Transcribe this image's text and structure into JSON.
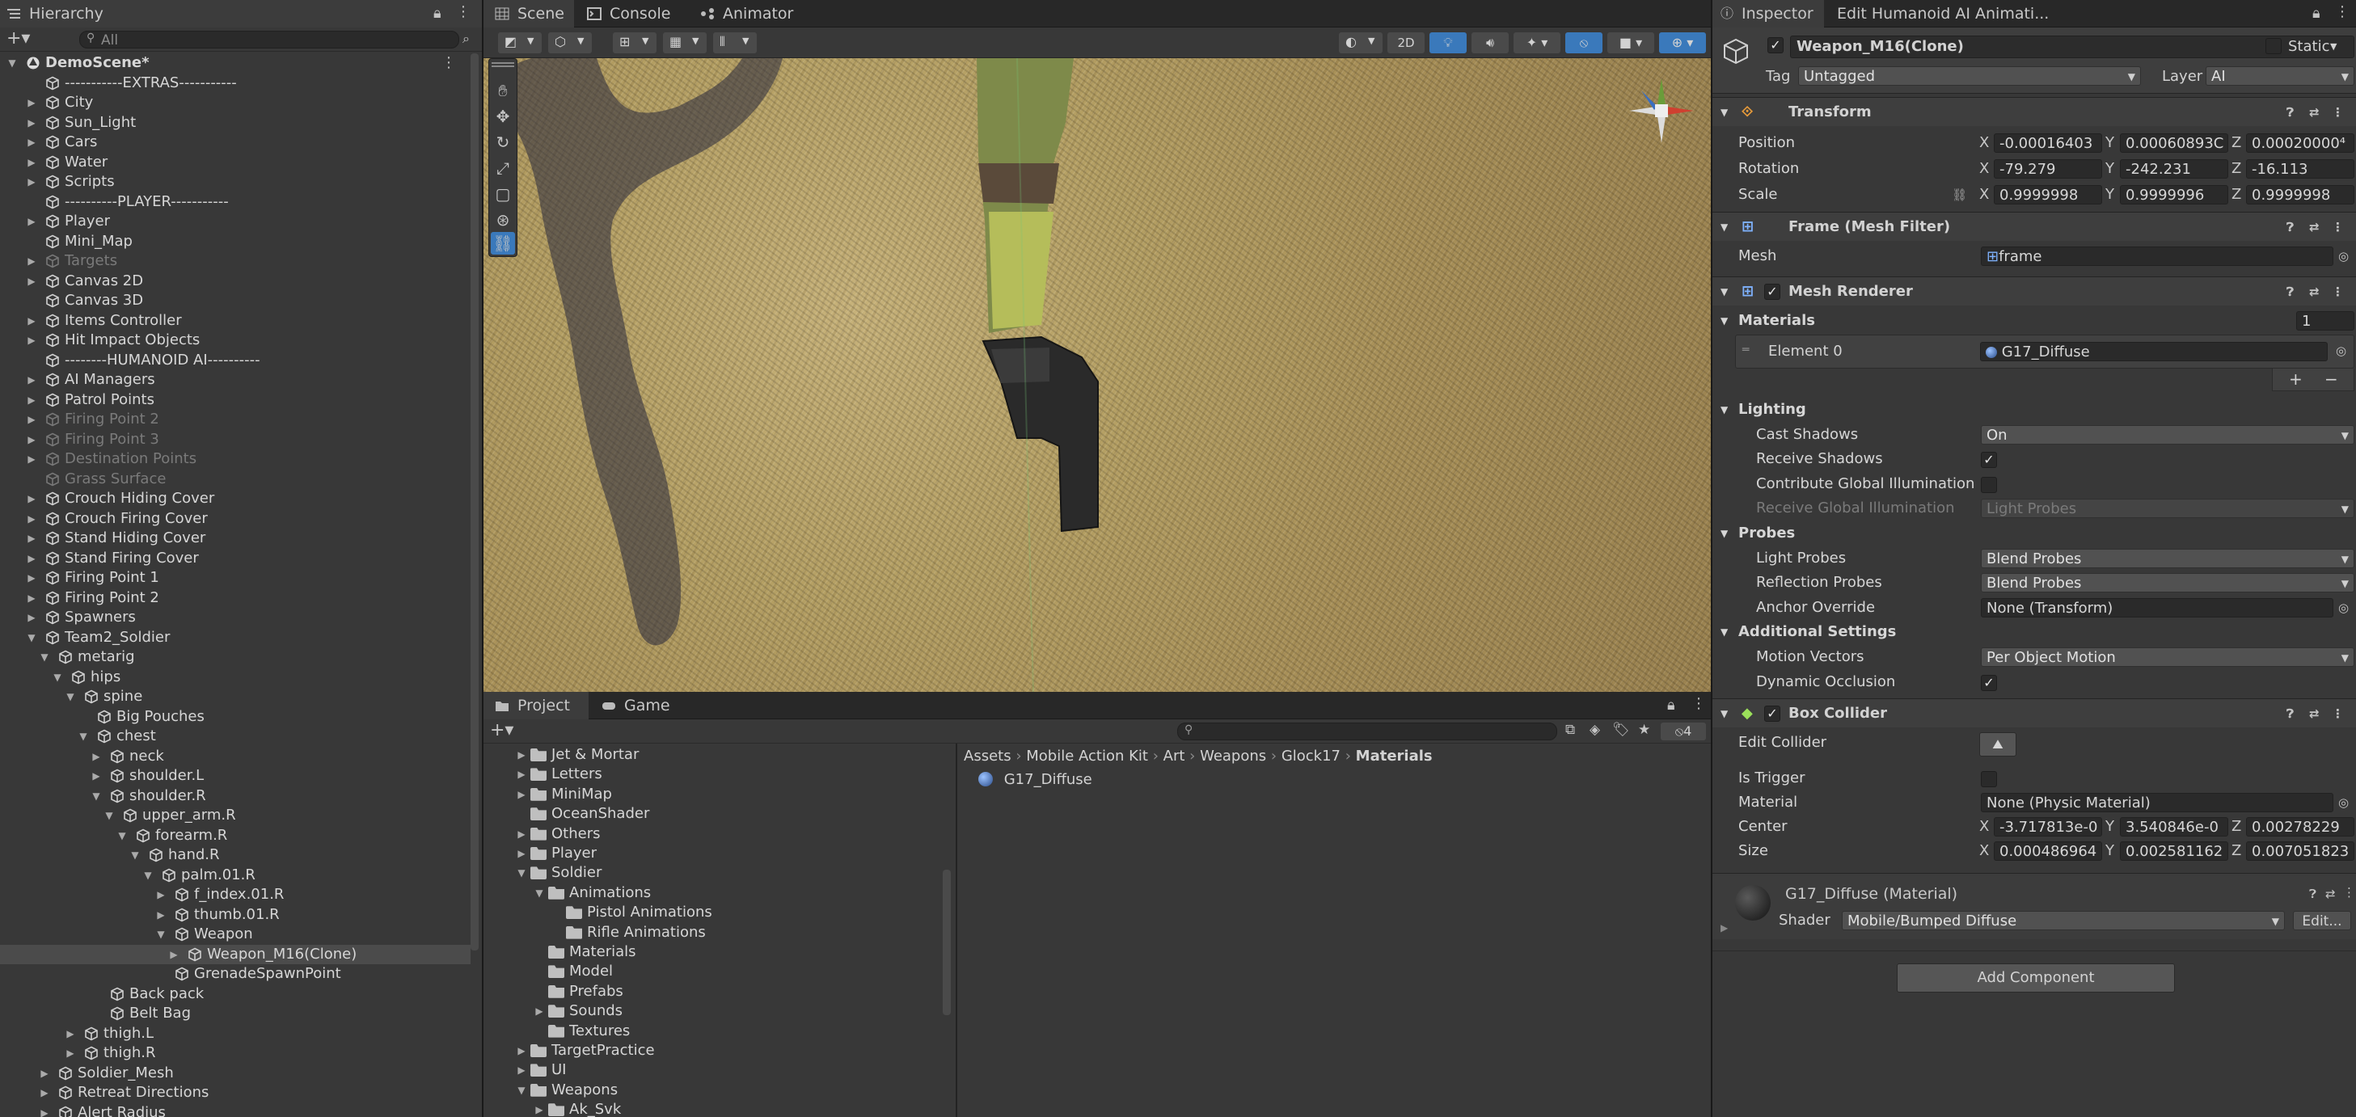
{
  "hierarchy": {
    "tab": "Hierarchy",
    "search_placeholder": "All",
    "rows": [
      {
        "label": "DemoScene*",
        "depth": 0,
        "arrow": "open",
        "icon": "unity",
        "dim": false,
        "bold": true
      },
      {
        "label": "-----------EXTRAS-----------",
        "depth": 2,
        "arrow": "",
        "dim": false
      },
      {
        "label": "City",
        "depth": 2,
        "arrow": "closed",
        "dim": false
      },
      {
        "label": "Sun_Light",
        "depth": 2,
        "arrow": "closed",
        "dim": false
      },
      {
        "label": "Cars",
        "depth": 2,
        "arrow": "closed",
        "dim": false
      },
      {
        "label": "Water",
        "depth": 2,
        "arrow": "closed",
        "dim": false
      },
      {
        "label": "Scripts",
        "depth": 2,
        "arrow": "closed",
        "dim": false
      },
      {
        "label": "----------PLAYER-----------",
        "depth": 2,
        "arrow": "",
        "dim": false
      },
      {
        "label": "Player",
        "depth": 2,
        "arrow": "closed",
        "dim": false
      },
      {
        "label": "Mini_Map",
        "depth": 2,
        "arrow": "",
        "dim": false
      },
      {
        "label": "Targets",
        "depth": 2,
        "arrow": "closed",
        "dim": true
      },
      {
        "label": "Canvas 2D",
        "depth": 2,
        "arrow": "closed",
        "dim": false
      },
      {
        "label": "Canvas 3D",
        "depth": 2,
        "arrow": "",
        "dim": false
      },
      {
        "label": "Items Controller",
        "depth": 2,
        "arrow": "closed",
        "dim": false
      },
      {
        "label": "Hit Impact Objects",
        "depth": 2,
        "arrow": "closed",
        "dim": false
      },
      {
        "label": "--------HUMANOID AI----------",
        "depth": 2,
        "arrow": "",
        "dim": false
      },
      {
        "label": "AI Managers",
        "depth": 2,
        "arrow": "closed",
        "dim": false
      },
      {
        "label": "Patrol Points",
        "depth": 2,
        "arrow": "closed",
        "dim": false
      },
      {
        "label": "Firing Point 2",
        "depth": 2,
        "arrow": "closed",
        "dim": true
      },
      {
        "label": "Firing Point 3",
        "depth": 2,
        "arrow": "closed",
        "dim": true
      },
      {
        "label": "Destination Points",
        "depth": 2,
        "arrow": "closed",
        "dim": true
      },
      {
        "label": "Grass Surface",
        "depth": 2,
        "arrow": "",
        "dim": true
      },
      {
        "label": "Crouch Hiding Cover",
        "depth": 2,
        "arrow": "closed",
        "dim": false
      },
      {
        "label": "Crouch Firing Cover",
        "depth": 2,
        "arrow": "closed",
        "dim": false
      },
      {
        "label": "Stand Hiding Cover",
        "depth": 2,
        "arrow": "closed",
        "dim": false
      },
      {
        "label": "Stand Firing Cover",
        "depth": 2,
        "arrow": "closed",
        "dim": false
      },
      {
        "label": "Firing Point 1",
        "depth": 2,
        "arrow": "closed",
        "dim": false
      },
      {
        "label": "Firing Point 2",
        "depth": 2,
        "arrow": "closed",
        "dim": false
      },
      {
        "label": "Spawners",
        "depth": 2,
        "arrow": "closed",
        "dim": false
      },
      {
        "label": "Team2_Soldier",
        "depth": 2,
        "arrow": "open",
        "dim": false
      },
      {
        "label": "metarig",
        "depth": 3,
        "arrow": "open",
        "dim": false
      },
      {
        "label": "hips",
        "depth": 4,
        "arrow": "open",
        "dim": false
      },
      {
        "label": "spine",
        "depth": 5,
        "arrow": "open",
        "dim": false
      },
      {
        "label": "Big Pouches",
        "depth": 6,
        "arrow": "",
        "dim": false
      },
      {
        "label": "chest",
        "depth": 6,
        "arrow": "open",
        "dim": false
      },
      {
        "label": "neck",
        "depth": 7,
        "arrow": "closed",
        "dim": false
      },
      {
        "label": "shoulder.L",
        "depth": 7,
        "arrow": "closed",
        "dim": false
      },
      {
        "label": "shoulder.R",
        "depth": 7,
        "arrow": "open",
        "dim": false
      },
      {
        "label": "upper_arm.R",
        "depth": 8,
        "arrow": "open",
        "dim": false
      },
      {
        "label": "forearm.R",
        "depth": 9,
        "arrow": "open",
        "dim": false
      },
      {
        "label": "hand.R",
        "depth": 10,
        "arrow": "open",
        "dim": false
      },
      {
        "label": "palm.01.R",
        "depth": 11,
        "arrow": "open",
        "dim": false
      },
      {
        "label": "f_index.01.R",
        "depth": 12,
        "arrow": "closed",
        "dim": false
      },
      {
        "label": "thumb.01.R",
        "depth": 12,
        "arrow": "closed",
        "dim": false
      },
      {
        "label": "Weapon",
        "depth": 12,
        "arrow": "open",
        "dim": false
      },
      {
        "label": "Weapon_M16(Clone)",
        "depth": 13,
        "arrow": "closed",
        "dim": false,
        "selected": true
      },
      {
        "label": "GrenadeSpawnPoint",
        "depth": 12,
        "arrow": "",
        "dim": false
      },
      {
        "label": "Back pack",
        "depth": 7,
        "arrow": "",
        "dim": false
      },
      {
        "label": "Belt Bag",
        "depth": 7,
        "arrow": "",
        "dim": false
      },
      {
        "label": "thigh.L",
        "depth": 5,
        "arrow": "closed",
        "dim": false
      },
      {
        "label": "thigh.R",
        "depth": 5,
        "arrow": "closed",
        "dim": false
      },
      {
        "label": "Soldier_Mesh",
        "depth": 3,
        "arrow": "closed",
        "dim": false
      },
      {
        "label": "Retreat Directions",
        "depth": 3,
        "arrow": "closed",
        "dim": false
      },
      {
        "label": "Alert Radius",
        "depth": 3,
        "arrow": "closed",
        "dim": false
      }
    ]
  },
  "scene": {
    "tabs": [
      "Scene",
      "Console",
      "Animator"
    ],
    "toolbar_2d": "2D"
  },
  "project": {
    "tabs": [
      "Project",
      "Game"
    ],
    "hidden_count": "4",
    "tree": [
      {
        "label": "Jet & Mortar",
        "depth": 0,
        "arrow": "closed"
      },
      {
        "label": "Letters",
        "depth": 0,
        "arrow": "closed"
      },
      {
        "label": "MiniMap",
        "depth": 0,
        "arrow": "closed"
      },
      {
        "label": "OceanShader",
        "depth": 0,
        "arrow": ""
      },
      {
        "label": "Others",
        "depth": 0,
        "arrow": "closed"
      },
      {
        "label": "Player",
        "depth": 0,
        "arrow": "closed"
      },
      {
        "label": "Soldier",
        "depth": 0,
        "arrow": "open"
      },
      {
        "label": "Animations",
        "depth": 1,
        "arrow": "open"
      },
      {
        "label": "Pistol Animations",
        "depth": 2,
        "arrow": ""
      },
      {
        "label": "Rifle Animations",
        "depth": 2,
        "arrow": ""
      },
      {
        "label": "Materials",
        "depth": 1,
        "arrow": ""
      },
      {
        "label": "Model",
        "depth": 1,
        "arrow": ""
      },
      {
        "label": "Prefabs",
        "depth": 1,
        "arrow": ""
      },
      {
        "label": "Sounds",
        "depth": 1,
        "arrow": "closed"
      },
      {
        "label": "Textures",
        "depth": 1,
        "arrow": ""
      },
      {
        "label": "TargetPractice",
        "depth": 0,
        "arrow": "closed"
      },
      {
        "label": "UI",
        "depth": 0,
        "arrow": "closed"
      },
      {
        "label": "Weapons",
        "depth": 0,
        "arrow": "open"
      },
      {
        "label": "Ak_Svk",
        "depth": 1,
        "arrow": "closed"
      }
    ],
    "breadcrumb": [
      "Assets",
      "Mobile Action Kit",
      "Art",
      "Weapons",
      "Glock17",
      "Materials"
    ],
    "asset": "G17_Diffuse"
  },
  "inspector": {
    "tabs": [
      "Inspector",
      "Edit Humanoid AI Animati..."
    ],
    "object_name": "Weapon_M16(Clone)",
    "static_label": "Static",
    "tag_label": "Tag",
    "tag_value": "Untagged",
    "layer_label": "Layer",
    "layer_value": "AI",
    "transform": {
      "title": "Transform",
      "position_label": "Position",
      "rotation_label": "Rotation",
      "scale_label": "Scale",
      "position": [
        "-0.00016403",
        "0.00060893C",
        "0.00020000⁴"
      ],
      "rotation": [
        "-79.279",
        "-242.231",
        "-16.113"
      ],
      "scale": [
        "0.9999998",
        "0.9999996",
        "0.9999998"
      ]
    },
    "mesh_filter": {
      "title": "Frame (Mesh Filter)",
      "mesh_label": "Mesh",
      "mesh_value": "frame"
    },
    "mesh_renderer": {
      "title": "Mesh Renderer",
      "materials_label": "Materials",
      "materials_count": "1",
      "element_label": "Element 0",
      "element_value": "G17_Diffuse",
      "lighting": "Lighting",
      "cast_shadows_label": "Cast Shadows",
      "cast_shadows_value": "On",
      "receive_shadows_label": "Receive Shadows",
      "contribute_gi_label": "Contribute Global Illumination",
      "receive_gi_label": "Receive Global Illumination",
      "receive_gi_value": "Light Probes",
      "probes": "Probes",
      "light_probes_label": "Light Probes",
      "light_probes_value": "Blend Probes",
      "reflection_probes_label": "Reflection Probes",
      "reflection_probes_value": "Blend Probes",
      "anchor_override_label": "Anchor Override",
      "anchor_override_value": "None (Transform)",
      "additional": "Additional Settings",
      "motion_vectors_label": "Motion Vectors",
      "motion_vectors_value": "Per Object Motion",
      "dynamic_occlusion_label": "Dynamic Occlusion"
    },
    "box_collider": {
      "title": "Box Collider",
      "edit_collider_label": "Edit Collider",
      "is_trigger_label": "Is Trigger",
      "material_label": "Material",
      "material_value": "None (Physic Material)",
      "center_label": "Center",
      "size_label": "Size",
      "center": [
        "-3.717813e-0",
        "3.540846e-0",
        "0.00278229"
      ],
      "size": [
        "0.000486964",
        "0.002581162",
        "0.007051823"
      ]
    },
    "material": {
      "title": "G17_Diffuse (Material)",
      "shader_label": "Shader",
      "shader_value": "Mobile/Bumped Diffuse",
      "edit_label": "Edit..."
    },
    "add_component": "Add Component"
  },
  "colors": {
    "panel": "#383838",
    "header": "#282828",
    "accent": "#3a79bb",
    "selection": "#4b4b4b"
  }
}
